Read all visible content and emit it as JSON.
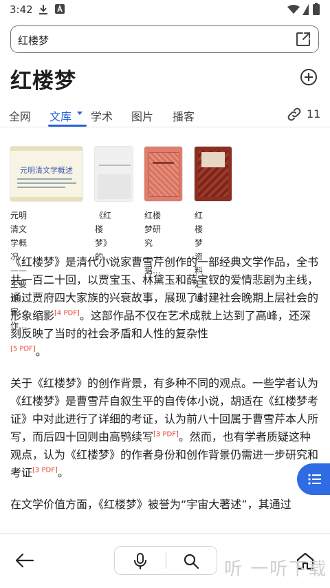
{
  "status": {
    "time": "3:42"
  },
  "search": {
    "query": "红楼梦"
  },
  "page": {
    "title": "红楼梦"
  },
  "tabs": [
    {
      "label": "全网"
    },
    {
      "label": "文库",
      "active": true
    },
    {
      "label": "学术"
    },
    {
      "label": "图片"
    },
    {
      "label": "播客"
    }
  ],
  "links": {
    "count": "11"
  },
  "books": [
    {
      "cover_title": "元明清文学概述",
      "caption_line1": "元明清文学概况",
      "caption_line2": "——主要作家、作..."
    },
    {
      "cover_title": "《红楼梦》的...",
      "caption_line1": "《红楼",
      "caption_line2": "梦》的..."
    },
    {
      "cover_title": "红楼梦研究",
      "caption_line1": "红楼梦研",
      "caption_line2": "究——据..."
    },
    {
      "cover_title": "红楼梦资料汇编",
      "caption_line1": "红楼梦资",
      "caption_line2": "料汇编"
    }
  ],
  "article": {
    "p1_a": "《红楼梦》是清代小说家曹雪芹创作的一部经典文学作品，全书共一百二十回，以贾宝玉、林黛玉和薛宝钗的爱情悲剧为主线，通过贾府四大家族的兴衰故事，展现了封建社会晚期上层社会的形象缩影",
    "p1_cite1": "[4 PDF]",
    "p1_b": "。这部作品不仅在艺术成就上达到了高峰，还深刻反映了当时的社会矛盾和人性的复杂性",
    "p1_cite2": "[5 PDF]",
    "p1_c": "。",
    "p2_a": "关于《红楼梦》的创作背景，有多种不同的观点。一些学者认为《红楼梦》是曹雪芹自叙生平的自传体小说，胡适在《红楼梦考证》中对此进行了详细的考证，认为前八十回属于曹雪芹本人所写，而后四十回则由高鹗续写",
    "p2_cite1": "[3 PDF]",
    "p2_b": "。然而，也有学者质疑这种观点，认为《红楼梦》的作者身份和创作背景仍需进一步研究和考证",
    "p2_cite2": "[3 PDF]",
    "p2_c": "。",
    "p3": "在文学价值方面，《红楼梦》被誉为“宇宙大著述”，其通过"
  },
  "watermark": "听 一听下载",
  "colors": {
    "accent": "#2463e0",
    "citation": "#e8412c",
    "fab": "#2f6be3"
  }
}
